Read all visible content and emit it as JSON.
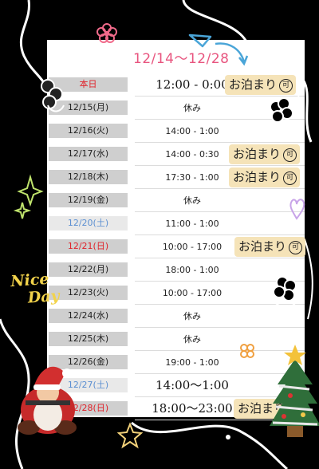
{
  "title": "12/14〜12/28",
  "schedule": [
    {
      "date": "本日",
      "time": "12:00 - 0:00",
      "date_color": "red",
      "badge": "お泊まり"
    },
    {
      "date": "12/15(月)",
      "time": "休み"
    },
    {
      "date": "12/16(火)",
      "time": "14:00 - 1:00"
    },
    {
      "date": "12/17(水)",
      "time": "14:00 - 0:30",
      "badge": "お泊まり"
    },
    {
      "date": "12/18(木)",
      "time": "17:30 - 1:00",
      "badge": "お泊まり"
    },
    {
      "date": "12/19(金)",
      "time": "休み"
    },
    {
      "date": "12/20(土)",
      "time": "11:00 - 1:00",
      "date_color": "blue"
    },
    {
      "date": "12/21(日)",
      "time": "10:00 - 17:00",
      "date_color": "red",
      "badge": "お泊まり"
    },
    {
      "date": "12/22(月)",
      "time": "18:00 - 1:00"
    },
    {
      "date": "12/23(火)",
      "time": "10:00 - 17:00"
    },
    {
      "date": "12/24(水)",
      "time": "休み"
    },
    {
      "date": "12/25(木)",
      "time": "休み"
    },
    {
      "date": "12/26(金)",
      "time": "19:00 - 1:00"
    },
    {
      "date": "12/27(土)",
      "time": "14:00〜1:00",
      "date_color": "blue"
    },
    {
      "date": "12/28(日)",
      "time": "18:00〜23:00",
      "date_color": "red",
      "badge": "お泊まり"
    }
  ],
  "badge_mark": "可",
  "decoration_text": {
    "line1": "Nice",
    "line2": "Day"
  },
  "colors": {
    "background": "#000000",
    "card": "#ffffff",
    "title": "#e8557f",
    "badge": "#f5e3b8",
    "weekday_blue": "#5b8fd1",
    "weekday_red": "#e0222a",
    "date_cell": "#cfcfcf",
    "nice_day": "#f2d34b"
  }
}
